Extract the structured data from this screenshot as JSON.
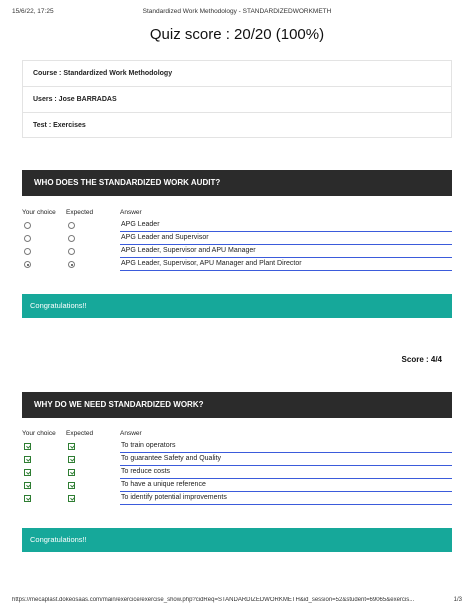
{
  "print_header": {
    "timestamp": "15/6/22, 17:25",
    "title": "Standardized Work Methodology - STANDARDIZEDWORKMETH"
  },
  "quiz_score": "Quiz score : 20/20 (100%)",
  "info": {
    "course": "Course : Standardized Work Methodology",
    "users": "Users : Jose BARRADAS",
    "test": "Test : Exercises"
  },
  "columns": {
    "your_choice": "Your choice",
    "expected": "Expected",
    "answer": "Answer"
  },
  "questions": [
    {
      "title": "WHO DOES THE STANDARDIZED WORK AUDIT?",
      "input_type": "radio",
      "answers": [
        {
          "text": "APG Leader",
          "choice": false,
          "expected": false
        },
        {
          "text": "APG Leader and Supervisor",
          "choice": false,
          "expected": false
        },
        {
          "text": "APG Leader, Supervisor and APU Manager",
          "choice": false,
          "expected": false
        },
        {
          "text": "APG Leader, Supervisor, APU Manager and Plant Director",
          "choice": true,
          "expected": true
        }
      ],
      "feedback": "Congratulations!!",
      "score": "Score : 4/4"
    },
    {
      "title": "WHY DO WE NEED STANDARDIZED WORK?",
      "input_type": "checkbox",
      "answers": [
        {
          "text": "To train operators",
          "choice": true,
          "expected": true
        },
        {
          "text": "To guarantee Safety and Quality",
          "choice": true,
          "expected": true
        },
        {
          "text": "To reduce costs",
          "choice": true,
          "expected": true
        },
        {
          "text": "To have a unique reference",
          "choice": true,
          "expected": true
        },
        {
          "text": "To identify potential improvements",
          "choice": true,
          "expected": true
        }
      ],
      "feedback": "Congratulations!!"
    }
  ],
  "print_footer": {
    "url": "https://mecaplast.dokeosaas.com/main/exercice/exercise_show.php?cidReq=STANDARDIZEDWORKMETH&id_session=52&student=69065&exercis...",
    "page": "1/3"
  },
  "colors": {
    "question_header_bg": "#2b2b2b",
    "congrats_bg": "#16a89a",
    "answer_underline": "#3b5bdb",
    "checkbox_green": "#2e7d32"
  }
}
